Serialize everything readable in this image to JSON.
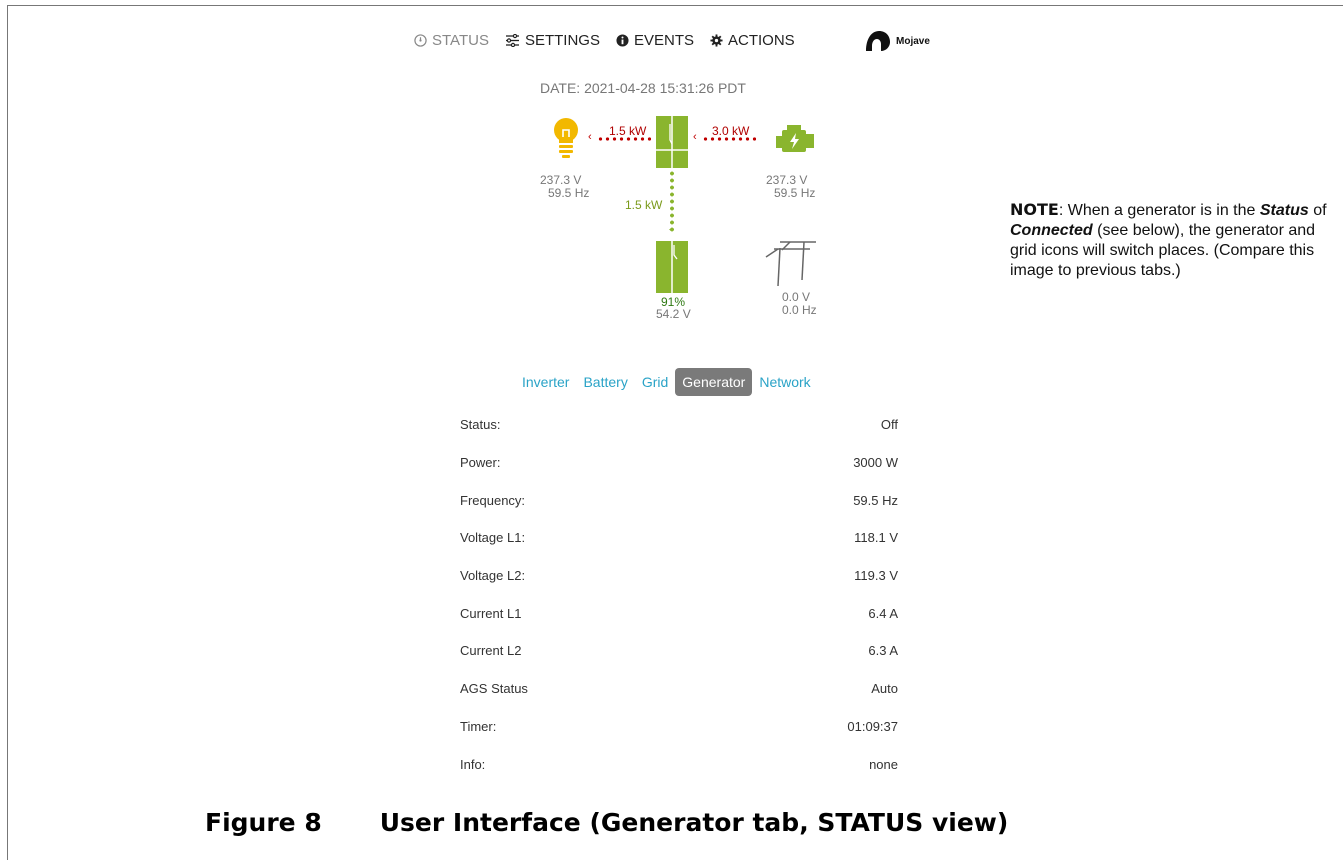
{
  "nav": {
    "items": [
      {
        "label": "STATUS",
        "icon": "gauge-icon"
      },
      {
        "label": "SETTINGS",
        "icon": "sliders-icon"
      },
      {
        "label": "EVENTS",
        "icon": "info-circle-icon"
      },
      {
        "label": "ACTIONS",
        "icon": "gear-icon"
      }
    ],
    "brand": "Mojave"
  },
  "date": "DATE: 2021-04-28 15:31:26 PDT",
  "flow": {
    "load": {
      "power": "1.5 kW",
      "voltage": "237.3 V",
      "frequency": "59.5 Hz"
    },
    "generator": {
      "power": "3.0 kW",
      "voltage": "237.3 V",
      "frequency": "59.5 Hz"
    },
    "battery": {
      "power": "1.5 kW",
      "soc": "91%",
      "voltage": "54.2 V"
    },
    "grid": {
      "voltage": "0.0 V",
      "frequency": "0.0 Hz"
    }
  },
  "tabs": [
    "Inverter",
    "Battery",
    "Grid",
    "Generator",
    "Network"
  ],
  "active_tab": "Generator",
  "rows": [
    {
      "label": "Status:",
      "value": "Off"
    },
    {
      "label": "Power:",
      "value": "3000 W"
    },
    {
      "label": "Frequency:",
      "value": "59.5 Hz"
    },
    {
      "label": "Voltage L1:",
      "value": "118.1 V"
    },
    {
      "label": "Voltage L2:",
      "value": "119.3 V"
    },
    {
      "label": "Current L1",
      "value": "6.4 A"
    },
    {
      "label": "Current L2",
      "value": "6.3 A"
    },
    {
      "label": "AGS Status",
      "value": "Auto"
    },
    {
      "label": "Timer:",
      "value": "01:09:37"
    },
    {
      "label": "Info:",
      "value": "none"
    }
  ],
  "note": {
    "heading": "NOTE",
    "text1": ":  When a generator is in the ",
    "status": "Status",
    "text2": " of ",
    "connected": "Connected",
    "text3": " (see below), the generator and grid icons will switch places. (Compare this image to previous tabs.)"
  },
  "caption": {
    "number": "Figure 8",
    "title": "User Interface (Generator tab, STATUS view)"
  },
  "colors": {
    "accent": "#2aa3c7",
    "green": "#8ab52e",
    "red": "#c00000",
    "bulb": "#f2b800",
    "active_tab": "#7a7a7a"
  }
}
